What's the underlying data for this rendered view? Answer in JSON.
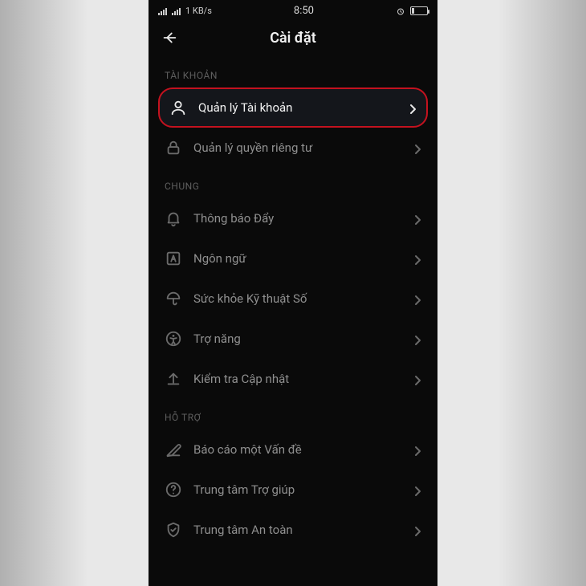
{
  "status": {
    "net_speed": "1 KB/s",
    "time": "8:50"
  },
  "header": {
    "title": "Cài đặt"
  },
  "sections": [
    {
      "title": "TÀI KHOẢN",
      "items": [
        {
          "label": "Quản lý Tài khoản",
          "icon": "user-icon",
          "highlight": true
        },
        {
          "label": "Quản lý quyền riêng tư",
          "icon": "lock-icon"
        }
      ]
    },
    {
      "title": "CHUNG",
      "items": [
        {
          "label": "Thông báo Đẩy",
          "icon": "bell-icon"
        },
        {
          "label": "Ngôn ngữ",
          "icon": "language-icon"
        },
        {
          "label": "Sức khỏe Kỹ thuật Số",
          "icon": "umbrella-icon"
        },
        {
          "label": "Trợ năng",
          "icon": "accessibility-icon"
        },
        {
          "label": "Kiểm tra Cập nhật",
          "icon": "update-icon"
        }
      ]
    },
    {
      "title": "HỖ TRỢ",
      "items": [
        {
          "label": "Báo cáo một Vấn đề",
          "icon": "report-icon"
        },
        {
          "label": "Trung tâm Trợ giúp",
          "icon": "help-icon"
        },
        {
          "label": "Trung tâm An toàn",
          "icon": "shield-icon"
        }
      ]
    }
  ]
}
